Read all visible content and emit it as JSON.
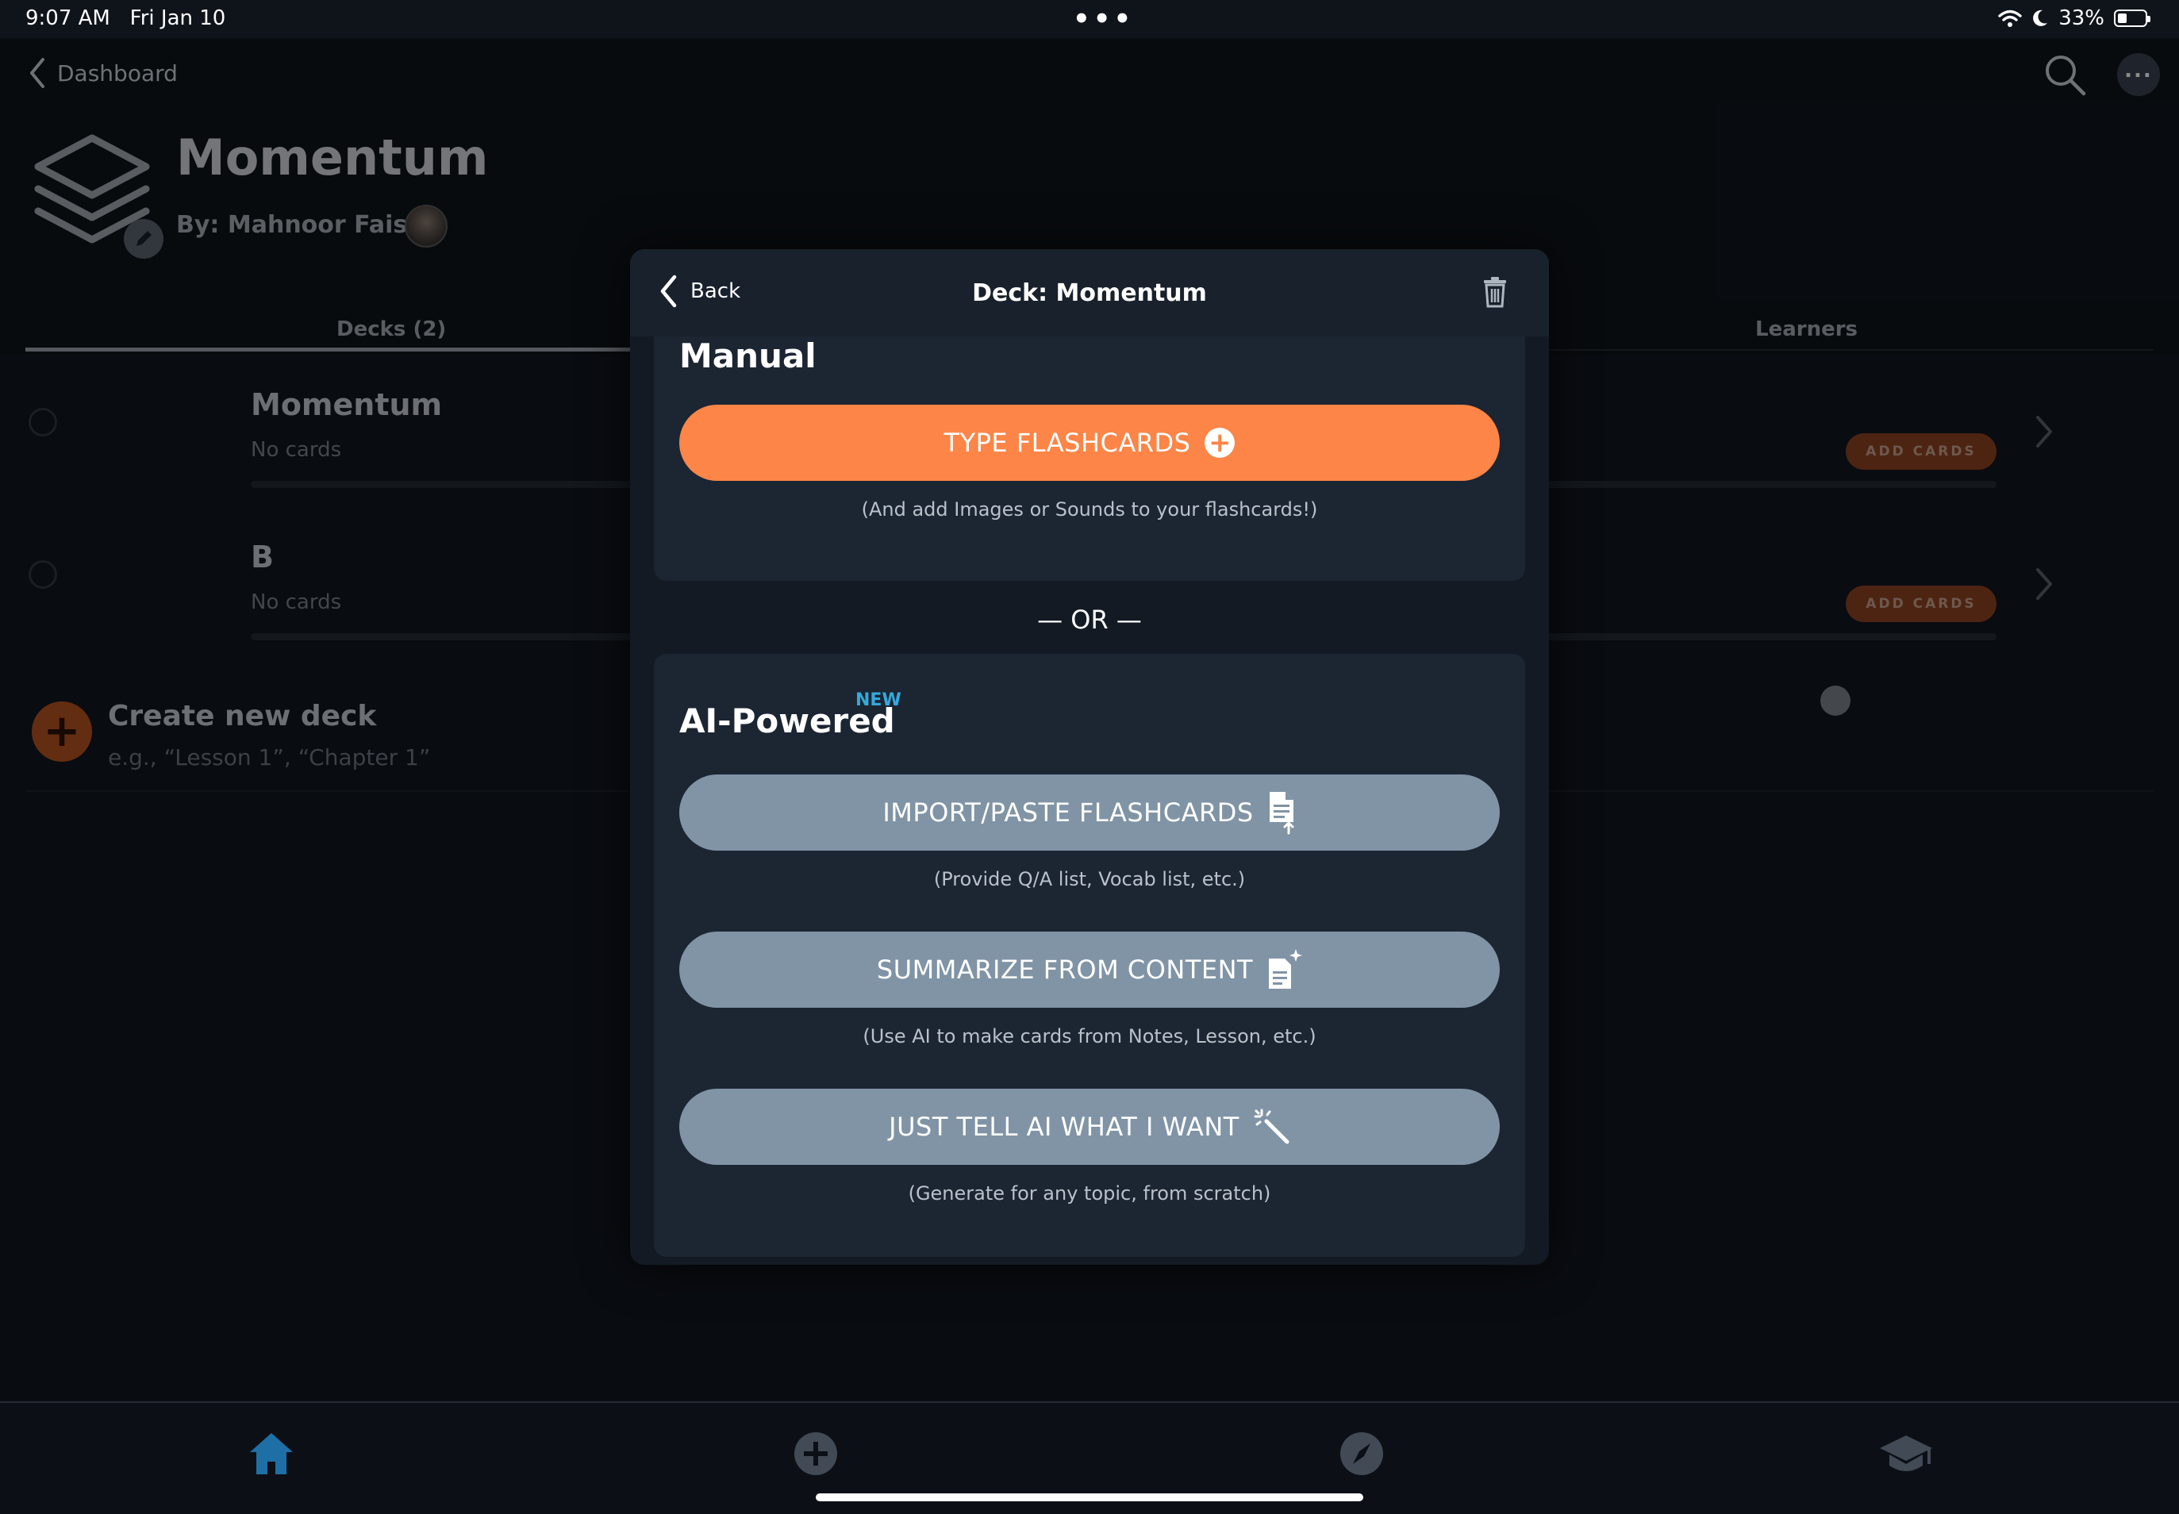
{
  "status_bar": {
    "time": "9:07 AM",
    "date": "Fri Jan 10",
    "center_dots": "•••",
    "battery": "33%",
    "battery_level": 0.33
  },
  "nav": {
    "back_label": "Dashboard"
  },
  "deck_header": {
    "title": "Momentum",
    "author": "By: Mahnoor Faisal"
  },
  "tabs": [
    {
      "label": "Decks (2)",
      "active": true
    },
    {
      "label": "Learners",
      "active": false
    }
  ],
  "decks": [
    {
      "title": "Momentum",
      "subtitle": "No cards",
      "action": "ADD CARDS"
    },
    {
      "title": "B",
      "subtitle": "No cards",
      "action": "ADD CARDS"
    }
  ],
  "create_deck": {
    "title": "Create new deck",
    "placeholder": "e.g., “Lesson 1”, “Chapter 1”"
  },
  "modal": {
    "back_label": "Back",
    "title": "Deck: Momentum",
    "manual": {
      "heading": "Manual",
      "button": "TYPE FLASHCARDS",
      "hint": "(And add Images or Sounds to your flashcards!)"
    },
    "separator": "— OR —",
    "ai": {
      "heading": "AI-Powered",
      "badge": "NEW",
      "options": [
        {
          "label": "IMPORT/PASTE FLASHCARDS",
          "hint": "(Provide Q/A list, Vocab list, etc.)",
          "icon": "document-import-icon"
        },
        {
          "label": "SUMMARIZE FROM CONTENT",
          "hint": "(Use AI to make cards from Notes, Lesson, etc.)",
          "icon": "document-sparkle-icon"
        },
        {
          "label": "JUST TELL AI WHAT I WANT",
          "hint": "(Generate for any topic, from scratch)",
          "icon": "magic-wand-icon"
        }
      ]
    }
  },
  "colors": {
    "accent_orange": "#fc8547",
    "ai_button": "#8094a6",
    "new_badge": "#35a9dc",
    "home_tab": "#1e6fa6"
  },
  "bottom_tabs": [
    "home-icon",
    "add-icon",
    "explore-icon",
    "learn-icon"
  ]
}
